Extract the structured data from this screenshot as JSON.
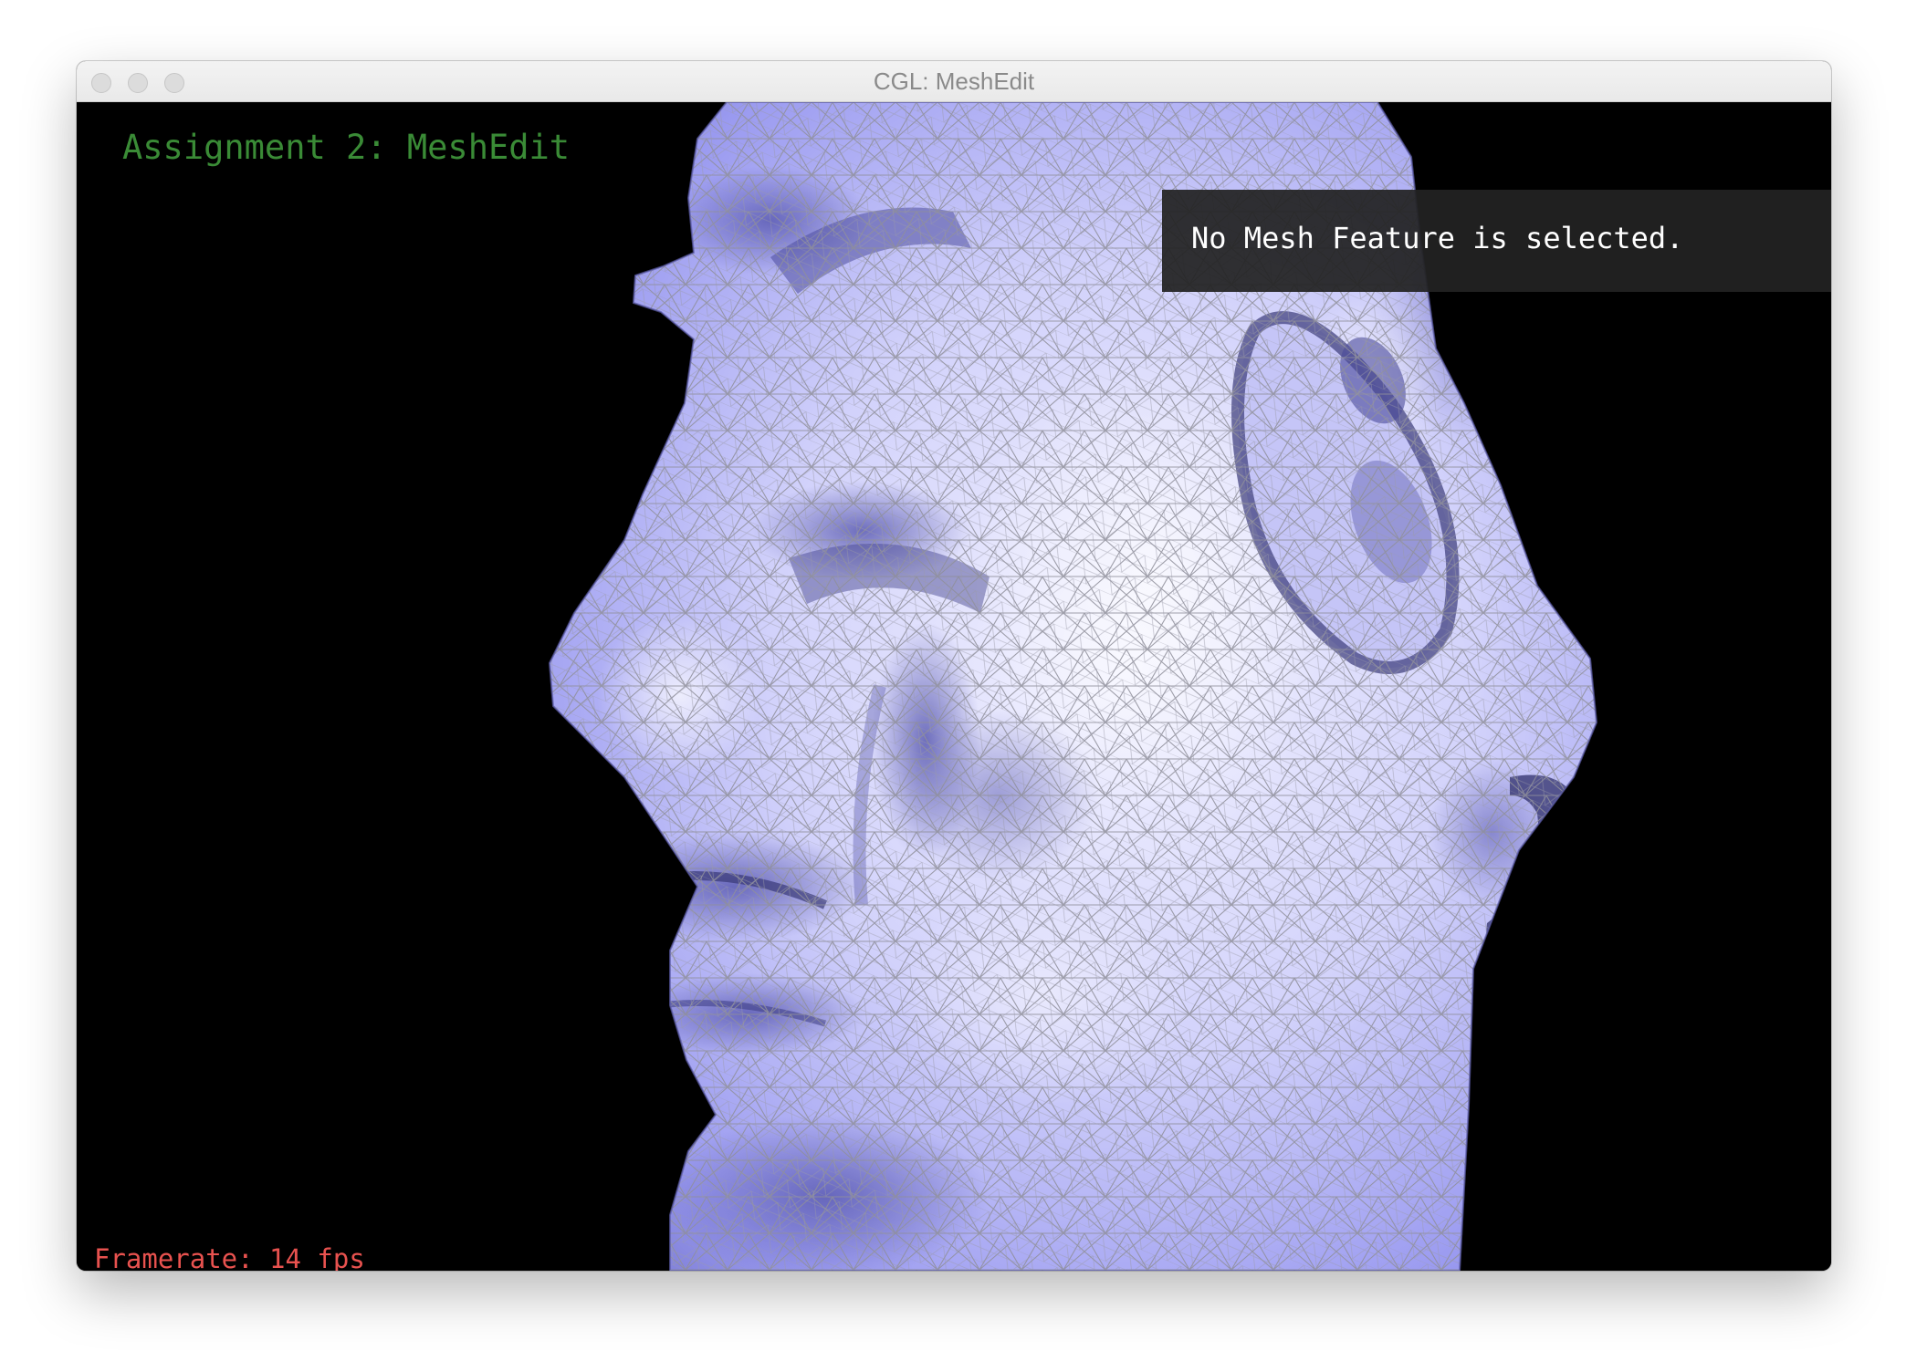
{
  "window": {
    "title": "CGL: MeshEdit",
    "controls": [
      "close",
      "minimize",
      "zoom"
    ]
  },
  "overlay": {
    "assignment_label": "Assignment 2: MeshEdit",
    "selection_info": "No Mesh Feature is selected.",
    "framerate": "Framerate: 14 fps"
  },
  "scene": {
    "object": "head-mesh",
    "mesh_color": "#9a9af5",
    "highlight_color": "#f2f2ff",
    "wireframe_color": "#8f8f9a",
    "background_color": "#000000"
  },
  "colors": {
    "assignment_text": "#3a8b36",
    "framerate_text": "#e8524f",
    "info_text": "#ffffff",
    "info_panel": "#222222"
  }
}
